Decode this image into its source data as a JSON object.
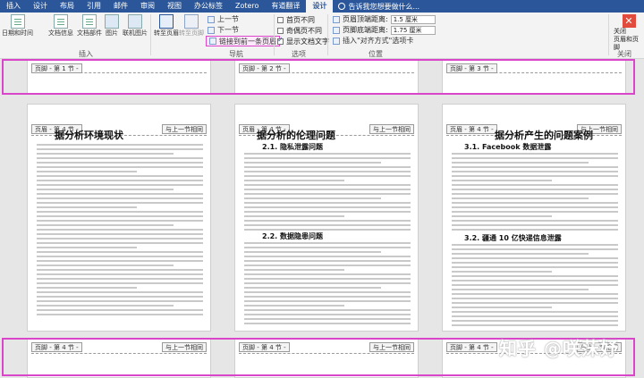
{
  "ribbon_tabs": [
    "插入",
    "设计",
    "布局",
    "引用",
    "邮件",
    "审阅",
    "视图",
    "办公标签",
    "Zotero",
    "有道翻译",
    "设计"
  ],
  "active_tab_index": 10,
  "tell_me": "告诉我您想要做什么...",
  "ribbon": {
    "insert_group": {
      "label": "插入",
      "buttons": [
        "日期和时间",
        "文档信息",
        "文档部件",
        "图片",
        "联机图片"
      ]
    },
    "nav_group": {
      "label": "导航",
      "goto_header": "转至页眉",
      "goto_footer": "转至页脚",
      "prev": "上一节",
      "next": "下一节",
      "link_prev": "链接到前一条页眉"
    },
    "options_group": {
      "label": "选项",
      "first_page": "首页不同",
      "odd_even": "奇偶页不同",
      "show_text": "显示文档文字"
    },
    "position_group": {
      "label": "位置",
      "header_top_label": "页眉顶端距离:",
      "header_top_value": "1.5 厘米",
      "footer_bottom_label": "页脚底端距离:",
      "footer_bottom_value": "1.75 厘米",
      "align_tab": "插入\"对齐方式\"选项卡"
    },
    "close_group": {
      "label": "关闭",
      "close_btn": "关闭\n页眉和页脚"
    }
  },
  "pages": {
    "top_row": [
      {
        "footer_tag": "页脚 - 第 1 节 -"
      },
      {
        "footer_tag": "页脚 - 第 2 节 -"
      },
      {
        "footer_tag": "页脚 - 第 3 节 -"
      }
    ],
    "middle_row": [
      {
        "header_tag": "页眉 - 第 4 节 -",
        "same_tag": "与上一节相同",
        "title": "据分析环境现状",
        "heading1": "",
        "heading2": ""
      },
      {
        "header_tag": "页眉 - 第 4 节 -",
        "same_tag": "与上一节相同",
        "title": "据分析的伦理问题",
        "heading1": "2.1. 隐私泄露问题",
        "heading2": "2.2. 数据隐患问题"
      },
      {
        "header_tag": "页眉 - 第 4 节 -",
        "same_tag": "与上一节相同",
        "title": "据分析产生的问题案例",
        "heading1": "3.1. Facebook 数据泄露",
        "heading2": "3.2. 疆通 10 亿快递信息泄露"
      }
    ],
    "bottom_row": [
      {
        "footer_tag": "页脚 - 第 4 节 -",
        "same_tag": "与上一节相同"
      },
      {
        "footer_tag": "页脚 - 第 4 节 -",
        "same_tag": "与上一节相同"
      },
      {
        "footer_tag": "页脚 - 第 4 节 -",
        "same_tag": "与上一节相同"
      }
    ]
  },
  "watermark": "知乎 @咲莯妤",
  "colors": {
    "ribbon_blue": "#2b579a",
    "highlight": "#d946c9",
    "close_red": "#e24a3b"
  }
}
